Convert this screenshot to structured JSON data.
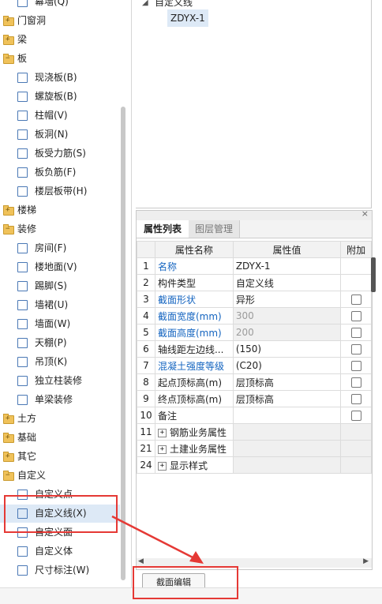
{
  "tree": {
    "items": [
      {
        "label": "幕墙(Q)",
        "kind": "child",
        "icon": "curtain-wall-icon"
      },
      {
        "label": "门窗洞",
        "kind": "folder",
        "icon": "folder-icon"
      },
      {
        "label": "梁",
        "kind": "folder",
        "icon": "folder-icon"
      },
      {
        "label": "板",
        "kind": "folder-open",
        "icon": "folder-icon"
      },
      {
        "label": "现浇板(B)",
        "kind": "child",
        "icon": "cast-slab-icon"
      },
      {
        "label": "螺旋板(B)",
        "kind": "child",
        "icon": "spiral-slab-icon"
      },
      {
        "label": "柱帽(V)",
        "kind": "child",
        "icon": "column-cap-icon"
      },
      {
        "label": "板洞(N)",
        "kind": "child",
        "icon": "slab-hole-icon"
      },
      {
        "label": "板受力筋(S)",
        "kind": "child",
        "icon": "slab-rebar-icon"
      },
      {
        "label": "板负筋(F)",
        "kind": "child",
        "icon": "negative-rebar-icon"
      },
      {
        "label": "楼层板带(H)",
        "kind": "child",
        "icon": "slab-strip-icon"
      },
      {
        "label": "楼梯",
        "kind": "folder",
        "icon": "folder-icon"
      },
      {
        "label": "装修",
        "kind": "folder-open",
        "icon": "folder-icon"
      },
      {
        "label": "房间(F)",
        "kind": "child",
        "icon": "room-icon"
      },
      {
        "label": "楼地面(V)",
        "kind": "child",
        "icon": "floor-icon"
      },
      {
        "label": "踢脚(S)",
        "kind": "child",
        "icon": "skirting-icon"
      },
      {
        "label": "墙裙(U)",
        "kind": "child",
        "icon": "dado-icon"
      },
      {
        "label": "墙面(W)",
        "kind": "child",
        "icon": "wall-face-icon"
      },
      {
        "label": "天棚(P)",
        "kind": "child",
        "icon": "ceiling-icon"
      },
      {
        "label": "吊顶(K)",
        "kind": "child",
        "icon": "suspended-ceiling-icon"
      },
      {
        "label": "独立柱装修",
        "kind": "child",
        "icon": "column-finish-icon"
      },
      {
        "label": "单梁装修",
        "kind": "child",
        "icon": "beam-finish-icon"
      },
      {
        "label": "土方",
        "kind": "folder",
        "icon": "folder-icon"
      },
      {
        "label": "基础",
        "kind": "folder",
        "icon": "folder-icon"
      },
      {
        "label": "其它",
        "kind": "folder",
        "icon": "folder-icon"
      },
      {
        "label": "自定义",
        "kind": "folder-open",
        "icon": "folder-icon"
      },
      {
        "label": "自定义点",
        "kind": "child",
        "icon": "custom-point-icon"
      },
      {
        "label": "自定义线(X)",
        "kind": "child",
        "icon": "custom-line-icon",
        "selected": true
      },
      {
        "label": "自定义面",
        "kind": "child",
        "icon": "custom-face-icon"
      },
      {
        "label": "自定义体",
        "kind": "child",
        "icon": "custom-body-icon"
      },
      {
        "label": "尺寸标注(W)",
        "kind": "child",
        "icon": "dimension-icon"
      }
    ]
  },
  "component_tree": {
    "root": "自定义线",
    "child": "ZDYX-1"
  },
  "props": {
    "tabs": [
      "属性列表",
      "图层管理"
    ],
    "headers": [
      "属性名称",
      "属性值",
      "附加"
    ],
    "rows": [
      {
        "num": "1",
        "name": "名称",
        "value": "ZDYX-1",
        "name_style": "blue",
        "value_style": "",
        "check": false
      },
      {
        "num": "2",
        "name": "构件类型",
        "value": "自定义线",
        "name_style": "",
        "value_style": "",
        "check": false
      },
      {
        "num": "3",
        "name": "截面形状",
        "value": "异形",
        "name_style": "blue",
        "value_style": "",
        "check": true
      },
      {
        "num": "4",
        "name": "截面宽度(mm)",
        "value": "300",
        "name_style": "blue",
        "value_style": "grey",
        "check": true,
        "shade": true
      },
      {
        "num": "5",
        "name": "截面高度(mm)",
        "value": "200",
        "name_style": "blue",
        "value_style": "grey",
        "check": true,
        "shade": true
      },
      {
        "num": "6",
        "name": "轴线距左边线...",
        "value": "(150)",
        "name_style": "",
        "value_style": "",
        "check": true
      },
      {
        "num": "7",
        "name": "混凝土强度等级",
        "value": "(C20)",
        "name_style": "blue",
        "value_style": "",
        "check": true
      },
      {
        "num": "8",
        "name": "起点顶标高(m)",
        "value": "层顶标高",
        "name_style": "",
        "value_style": "",
        "check": true
      },
      {
        "num": "9",
        "name": "终点顶标高(m)",
        "value": "层顶标高",
        "name_style": "",
        "value_style": "",
        "check": true
      },
      {
        "num": "10",
        "name": "备注",
        "value": "",
        "name_style": "",
        "value_style": "",
        "check": true
      },
      {
        "num": "11",
        "name": "钢筋业务属性",
        "value": "",
        "group": true
      },
      {
        "num": "21",
        "name": "土建业务属性",
        "value": "",
        "group": true
      },
      {
        "num": "24",
        "name": "显示样式",
        "value": "",
        "group": true
      }
    ]
  },
  "buttons": {
    "section_edit": "截面编辑",
    "close": "×"
  },
  "colors": {
    "selection": "#dde9f6",
    "annotation_red": "#e53935",
    "link_blue": "#1565c0"
  }
}
